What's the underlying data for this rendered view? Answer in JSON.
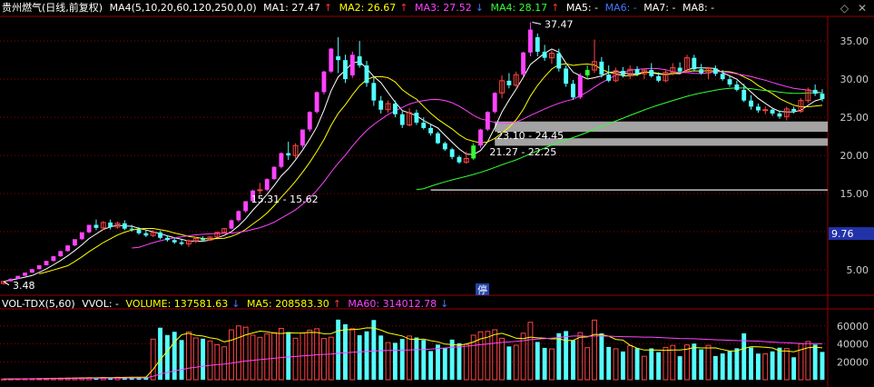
{
  "header": {
    "stock_name": "贵州燃气(日线,前复权)",
    "indicator": "MA4(5,10,20,60,120,250,0,0)",
    "ma1": "MA1: 27.47",
    "ma1_arrow": "↑",
    "ma2": "MA2: 26.67",
    "ma2_arrow": "↑",
    "ma3": "MA3: 27.52",
    "ma3_arrow": "↓",
    "ma4": "MA4: 28.17",
    "ma4_arrow": "↑",
    "ma5": "MA5: -",
    "ma6": "MA6: -",
    "ma7": "MA7: -",
    "ma8": "MA8: -"
  },
  "vol_header": {
    "indicator": "VOL-TDX(5,60)",
    "vvol": "VVOL: -",
    "volume": "VOLUME: 137581.63",
    "volume_arrow": "↓",
    "ma5": "MA5: 208583.30",
    "ma5_arrow": "↑",
    "ma60": "MA60: 314012.78",
    "ma60_arrow": "↓"
  },
  "icons": [
    "diamond-icon",
    "close-icon"
  ],
  "colors": {
    "up": "#ff4444",
    "down": "#55ffff",
    "limit_up": "#ff44ff",
    "green": "#33ff33",
    "ma5": "#ffffff",
    "ma10": "#ffff00",
    "ma20": "#ff44ff",
    "ma60": "#33ff33",
    "grid": "#990000",
    "zone": "#bfbfbf"
  },
  "chart_data": {
    "type": "candlestick",
    "y_ticks": [
      "35.00",
      "30.00",
      "25.00",
      "20.00",
      "15.00",
      "10.00",
      "5.00"
    ],
    "y_range": [
      2.5,
      38
    ],
    "current_price_label": "9.76",
    "annotations": [
      "37.47",
      "3.48",
      "15.31 - 15.62",
      "23.10 - 24.45",
      "21.27 - 22.25"
    ],
    "suspension_marker": "停",
    "zones": [
      [
        23.1,
        24.45
      ],
      [
        21.27,
        22.25
      ],
      [
        15.31,
        15.62
      ]
    ],
    "candles_ohlc": [
      [
        3.2,
        3.5,
        3.1,
        3.48
      ],
      [
        3.5,
        3.85,
        3.45,
        3.83
      ],
      [
        3.83,
        4.2,
        3.8,
        4.21
      ],
      [
        4.21,
        4.65,
        4.2,
        4.63
      ],
      [
        4.63,
        5.1,
        4.6,
        5.09
      ],
      [
        5.09,
        5.6,
        5.05,
        5.6
      ],
      [
        5.6,
        6.2,
        5.55,
        6.16
      ],
      [
        6.16,
        6.8,
        6.1,
        6.78
      ],
      [
        6.78,
        7.5,
        6.7,
        7.45
      ],
      [
        7.45,
        8.2,
        7.4,
        8.2
      ],
      [
        8.2,
        9.0,
        8.1,
        9.02
      ],
      [
        9.02,
        9.9,
        8.9,
        9.92
      ],
      [
        9.92,
        10.9,
        9.8,
        10.9
      ],
      [
        10.9,
        11.6,
        10.2,
        10.5
      ],
      [
        10.5,
        11.4,
        10.2,
        11.2
      ],
      [
        11.2,
        11.6,
        10.3,
        10.6
      ],
      [
        10.6,
        11.3,
        10.4,
        11.1
      ],
      [
        11.1,
        11.5,
        10.2,
        10.4
      ],
      [
        10.4,
        10.9,
        10.0,
        10.3
      ],
      [
        10.3,
        10.6,
        9.6,
        9.8
      ],
      [
        9.8,
        10.2,
        9.3,
        9.5
      ],
      [
        9.5,
        10.2,
        9.3,
        9.9
      ],
      [
        9.9,
        10.1,
        9.0,
        9.2
      ],
      [
        9.2,
        9.5,
        8.7,
        8.9
      ],
      [
        8.9,
        9.2,
        8.4,
        8.6
      ],
      [
        8.6,
        9.0,
        8.2,
        8.4
      ],
      [
        8.4,
        9.0,
        8.0,
        8.8
      ],
      [
        8.8,
        9.3,
        8.5,
        9.1
      ],
      [
        9.1,
        9.4,
        8.7,
        8.9
      ],
      [
        8.9,
        9.4,
        8.8,
        9.3
      ],
      [
        9.3,
        10.0,
        9.2,
        9.9
      ],
      [
        9.9,
        10.5,
        9.8,
        10.4
      ],
      [
        10.4,
        11.6,
        10.3,
        11.5
      ],
      [
        11.5,
        12.8,
        11.3,
        12.7
      ],
      [
        12.7,
        14.0,
        12.5,
        14.0
      ],
      [
        14.0,
        15.5,
        13.8,
        15.4
      ],
      [
        15.4,
        16.4,
        14.9,
        15.5
      ],
      [
        15.5,
        17.0,
        15.3,
        16.9
      ],
      [
        16.9,
        18.6,
        16.8,
        18.5
      ],
      [
        18.5,
        20.4,
        18.3,
        20.3
      ],
      [
        20.3,
        21.8,
        19.4,
        20.0
      ],
      [
        20.0,
        21.6,
        19.6,
        21.3
      ],
      [
        21.3,
        23.4,
        21.0,
        23.4
      ],
      [
        23.4,
        25.8,
        23.1,
        25.7
      ],
      [
        25.7,
        28.4,
        25.5,
        28.3
      ],
      [
        28.3,
        31.1,
        28.0,
        31.0
      ],
      [
        31.0,
        34.1,
        30.8,
        34.0
      ],
      [
        33.0,
        35.5,
        30.8,
        32.5
      ],
      [
        32.5,
        33.2,
        29.5,
        30.0
      ],
      [
        30.5,
        33.6,
        30.2,
        33.2
      ],
      [
        33.0,
        35.0,
        31.5,
        31.8
      ],
      [
        31.8,
        32.4,
        29.0,
        29.5
      ],
      [
        29.5,
        30.4,
        26.5,
        27.2
      ],
      [
        27.2,
        27.8,
        25.5,
        26.0
      ],
      [
        26.0,
        27.2,
        25.6,
        26.8
      ],
      [
        26.8,
        27.2,
        25.0,
        25.4
      ],
      [
        25.4,
        25.8,
        23.6,
        24.0
      ],
      [
        24.0,
        26.2,
        23.8,
        25.6
      ],
      [
        25.6,
        26.0,
        24.0,
        24.3
      ],
      [
        24.3,
        25.0,
        23.4,
        23.6
      ],
      [
        23.6,
        24.0,
        22.6,
        22.9
      ],
      [
        22.9,
        23.1,
        21.5,
        21.6
      ],
      [
        21.6,
        21.8,
        20.6,
        20.8
      ],
      [
        20.8,
        21.0,
        19.5,
        19.8
      ],
      [
        19.8,
        20.0,
        18.9,
        19.1
      ],
      [
        19.1,
        20.5,
        18.9,
        19.6
      ],
      [
        19.6,
        21.6,
        19.4,
        21.3
      ],
      [
        21.3,
        23.5,
        21.0,
        23.4
      ],
      [
        23.4,
        25.8,
        23.2,
        25.7
      ],
      [
        25.7,
        28.3,
        25.5,
        28.2
      ],
      [
        28.2,
        30.5,
        27.5,
        29.8
      ],
      [
        29.8,
        30.8,
        28.8,
        29.2
      ],
      [
        29.2,
        31.0,
        29.0,
        30.6
      ],
      [
        30.6,
        33.6,
        30.4,
        33.5
      ],
      [
        33.5,
        37.47,
        33.0,
        36.5
      ],
      [
        35.5,
        36.0,
        33.0,
        33.6
      ],
      [
        33.6,
        34.5,
        32.4,
        32.8
      ],
      [
        32.8,
        33.8,
        32.0,
        33.4
      ],
      [
        33.4,
        34.0,
        31.0,
        31.4
      ],
      [
        31.4,
        31.8,
        29.0,
        29.4
      ],
      [
        29.4,
        29.9,
        27.3,
        27.6
      ],
      [
        27.6,
        30.8,
        27.4,
        30.5
      ],
      [
        30.5,
        31.8,
        30.0,
        31.2
      ],
      [
        31.2,
        35.2,
        30.8,
        32.3
      ],
      [
        32.3,
        32.9,
        30.2,
        30.6
      ],
      [
        30.6,
        31.8,
        29.6,
        29.8
      ],
      [
        29.8,
        31.5,
        29.6,
        31.1
      ],
      [
        31.1,
        31.6,
        30.2,
        30.5
      ],
      [
        30.5,
        31.8,
        30.0,
        31.3
      ],
      [
        31.3,
        31.7,
        30.4,
        30.7
      ],
      [
        30.7,
        31.4,
        30.0,
        31.2
      ],
      [
        31.2,
        32.1,
        30.2,
        30.4
      ],
      [
        30.4,
        30.9,
        29.6,
        29.8
      ],
      [
        29.8,
        31.2,
        29.6,
        30.9
      ],
      [
        30.9,
        32.1,
        30.5,
        31.5
      ],
      [
        31.5,
        32.2,
        30.8,
        31.0
      ],
      [
        31.0,
        33.2,
        30.8,
        32.8
      ],
      [
        32.8,
        33.2,
        31.0,
        31.3
      ],
      [
        31.3,
        32.0,
        30.6,
        30.8
      ],
      [
        30.8,
        31.6,
        30.0,
        31.4
      ],
      [
        31.4,
        31.8,
        30.4,
        30.7
      ],
      [
        30.7,
        31.2,
        29.8,
        30.0
      ],
      [
        30.0,
        30.4,
        29.0,
        29.3
      ],
      [
        29.3,
        29.8,
        28.4,
        28.6
      ],
      [
        28.6,
        29.4,
        27.0,
        27.2
      ],
      [
        27.2,
        27.9,
        26.0,
        26.4
      ],
      [
        26.4,
        26.8,
        25.6,
        25.9
      ],
      [
        25.9,
        26.4,
        25.4,
        26.0
      ],
      [
        26.0,
        26.2,
        25.2,
        25.5
      ],
      [
        25.5,
        25.9,
        24.8,
        25.1
      ],
      [
        25.1,
        26.4,
        24.6,
        26.1
      ],
      [
        26.1,
        26.4,
        25.5,
        25.8
      ],
      [
        25.8,
        27.5,
        25.6,
        27.2
      ],
      [
        27.2,
        28.9,
        26.9,
        28.6
      ],
      [
        28.6,
        29.3,
        27.8,
        28.1
      ],
      [
        28.1,
        28.7,
        27.1,
        27.4
      ]
    ],
    "volume_ticks": [
      "60000",
      "40000",
      "20000"
    ],
    "volume_range": [
      0,
      75000
    ]
  }
}
